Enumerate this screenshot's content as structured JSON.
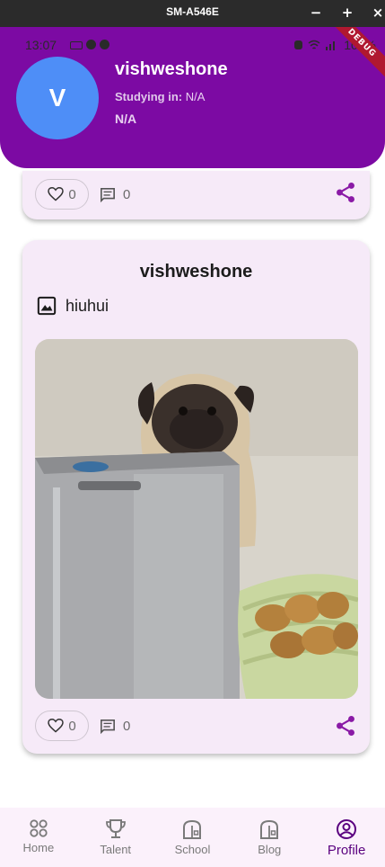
{
  "window": {
    "title": "SM-A546E",
    "minimize": "−",
    "maximize": "+",
    "close": "×"
  },
  "status_bar": {
    "time": "13:07",
    "battery": "100%"
  },
  "debug_banner": "DEBUG",
  "profile": {
    "avatar_initial": "V",
    "name": "vishweshone",
    "studying_label": "Studying in:",
    "studying_value": "N/A",
    "school": "N/A"
  },
  "previous_post": {
    "likes": "0",
    "comments": "0"
  },
  "post": {
    "author": "vishweshone",
    "caption": "hiuhui",
    "likes": "0",
    "comments": "0"
  },
  "bottom_nav": {
    "items": [
      {
        "label": "Home",
        "icon": "grid-icon"
      },
      {
        "label": "Talent",
        "icon": "trophy-icon"
      },
      {
        "label": "School",
        "icon": "school-building-icon"
      },
      {
        "label": "Blog",
        "icon": "blog-building-icon"
      },
      {
        "label": "Profile",
        "icon": "account-circle-icon"
      }
    ],
    "active": "Profile"
  },
  "colors": {
    "header": "#7c0aa3",
    "avatar": "#4e8ef7",
    "accent": "#8a1aa6",
    "card": "#f6eaf8"
  }
}
